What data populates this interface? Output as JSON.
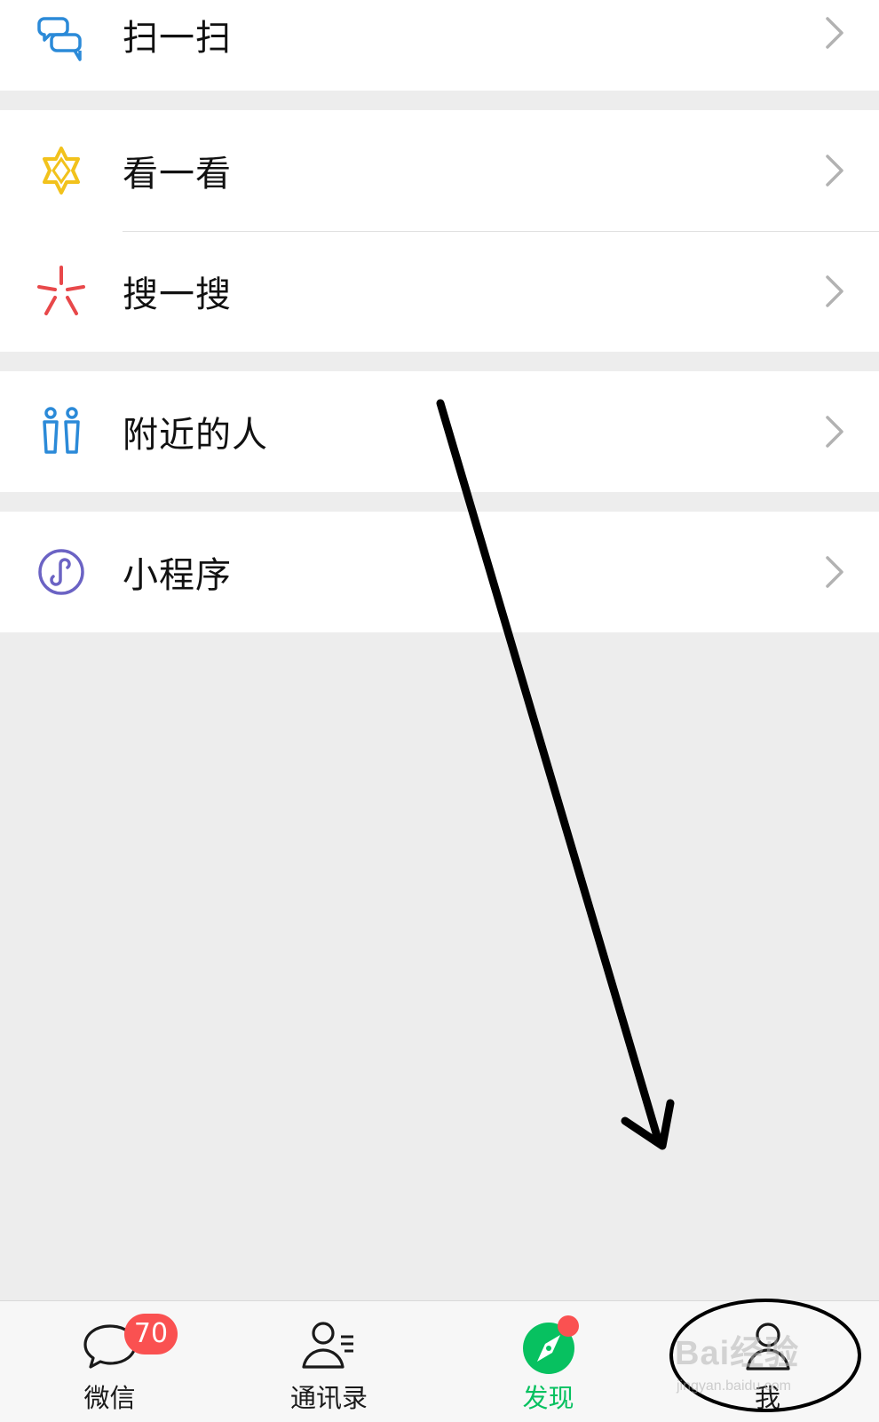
{
  "menu": {
    "groups": [
      {
        "items": [
          {
            "label": "扫一扫",
            "icon": "scan-icon"
          }
        ]
      },
      {
        "items": [
          {
            "label": "看一看",
            "icon": "top-stories-icon"
          },
          {
            "label": "搜一搜",
            "icon": "search-icon"
          }
        ]
      },
      {
        "items": [
          {
            "label": "附近的人",
            "icon": "people-nearby-icon"
          }
        ]
      },
      {
        "items": [
          {
            "label": "小程序",
            "icon": "mini-programs-icon"
          }
        ]
      }
    ]
  },
  "tabbar": {
    "tabs": [
      {
        "label": "微信",
        "icon": "chat-bubble-icon",
        "badge": "70",
        "active": false
      },
      {
        "label": "通讯录",
        "icon": "contacts-icon",
        "active": false
      },
      {
        "label": "发现",
        "icon": "compass-icon",
        "active": true,
        "dot": true
      },
      {
        "label": "我",
        "icon": "person-icon",
        "active": false
      }
    ]
  },
  "annotation": {
    "watermark": "Bai经验",
    "watermark_sub": "jingyan.baidu.com"
  },
  "colors": {
    "accent": "#07c160",
    "badge": "#fa5151",
    "scan_icon": "#2b8ad8",
    "top_stories_icon": "#f2c21c",
    "search_icon": "#e8484a",
    "people_nearby_icon": "#2b8ad8",
    "mini_programs_icon": "#6b63c4",
    "background": "#ededed"
  }
}
